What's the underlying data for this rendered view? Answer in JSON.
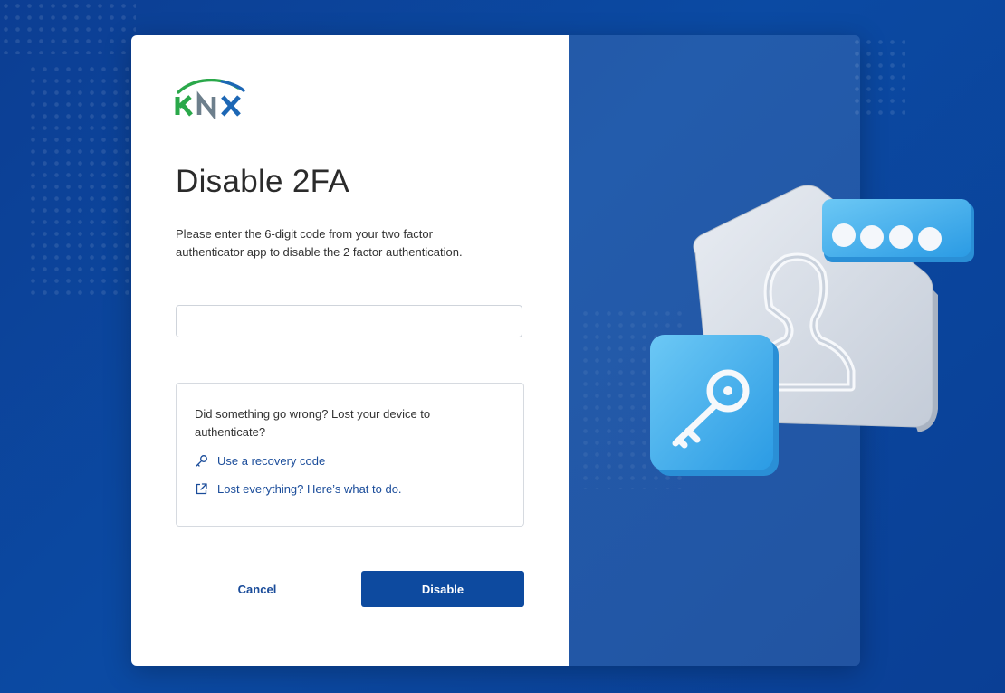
{
  "brand": {
    "logo_text": "KNX",
    "colors": {
      "green": "#2aa84a",
      "blue": "#1d67b5",
      "gray": "#6d7f8c"
    }
  },
  "page": {
    "title": "Disable 2FA",
    "description": "Please enter the 6-digit code from your two factor authenticator app to disable the 2 factor authentication."
  },
  "code_input": {
    "value": "",
    "placeholder": ""
  },
  "help": {
    "text": "Did something go wrong? Lost your device to authenticate?",
    "links": [
      {
        "label": "Use a recovery code",
        "icon": "key-icon"
      },
      {
        "label": "Lost everything? Here’s what to do.",
        "icon": "external-link-icon"
      }
    ]
  },
  "actions": {
    "cancel_label": "Cancel",
    "disable_label": "Disable"
  },
  "colors": {
    "background": "#0b4aa3",
    "primary_button": "#0d4a9f",
    "link": "#1a4c9a"
  }
}
